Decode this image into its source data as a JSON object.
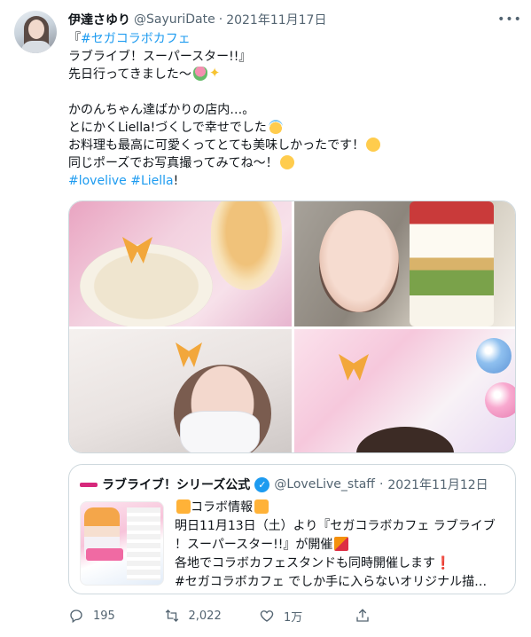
{
  "tweet": {
    "author_name": "伊達さゆり",
    "author_handle": "@SayuriDate",
    "separator": "·",
    "date": "2021年11月17日",
    "more_label": "•••",
    "lines": {
      "l1_prefix": "『",
      "l1_hashtag": "#セガコラボカフェ",
      "l2": "ラブライブ！スーパースター!!』",
      "l3": "先日行ってきました〜",
      "l5": "かのんちゃん達ばかりの店内…。",
      "l6": "とにかくLiella!づくしで幸せでした",
      "l7": "お料理も最高に可愛くってとても美味しかったです！",
      "l8": "同じポーズでお写真撮ってみてね〜！",
      "hashtag1": "#lovelive",
      "hashtag2": "#Liella",
      "hashtag_suffix": "!"
    },
    "emojis": [
      "tulip-emoji",
      "sparkles-emoji",
      "halo-face-emoji",
      "relieved-face-emoji",
      "winking-face-emoji"
    ]
  },
  "media": {
    "photos": [
      "food-and-drink-photo",
      "parfait-selfie-photo",
      "masked-pose-photo",
      "mural-pose-photo"
    ]
  },
  "quote": {
    "author_name": "ラブライブ！シリーズ公式",
    "author_handle": "@LoveLive_staff",
    "separator": "·",
    "date": "2021年11月12日",
    "lines": {
      "l1": "コラボ情報",
      "l2": "明日11月13日（土）より『セガコラボカフェ ラブライブ",
      "l3": "！スーパースター!!』が開催",
      "l4": "各地でコラボカフェスタンドも同時開催します",
      "l4_mark": "❗",
      "l5": "#セガコラボカフェ でしか手に入らないオリジナル描…"
    }
  },
  "actions": {
    "reply_count": "195",
    "retweet_count": "2,022",
    "like_count": "1万",
    "share_label": ""
  },
  "colors": {
    "text": "#0f1419",
    "secondary": "#536471",
    "link": "#1d9bf0",
    "border": "#cfd9de"
  }
}
